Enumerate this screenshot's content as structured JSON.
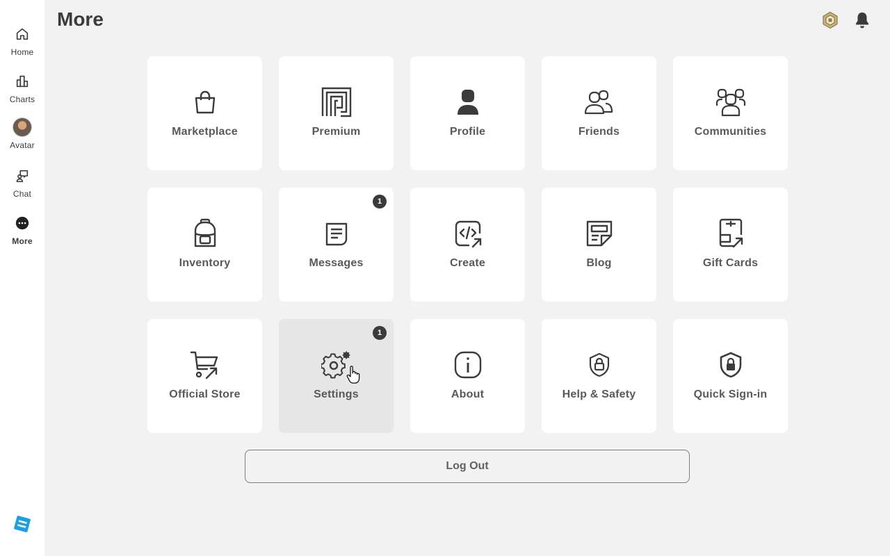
{
  "header": {
    "title": "More",
    "robux_icon": "robux-icon",
    "notification_icon": "bell-icon"
  },
  "sidebar": {
    "items": [
      {
        "label": "Home",
        "icon": "home-icon"
      },
      {
        "label": "Charts",
        "icon": "charts-icon"
      },
      {
        "label": "Avatar",
        "icon": "avatar-thumbnail"
      },
      {
        "label": "Chat",
        "icon": "chat-icon"
      },
      {
        "label": "More",
        "icon": "more-icon",
        "active": true
      }
    ],
    "logo": "roblox-logo"
  },
  "tiles": [
    {
      "label": "Marketplace",
      "icon": "shopping-bag-icon"
    },
    {
      "label": "Premium",
      "icon": "premium-icon"
    },
    {
      "label": "Profile",
      "icon": "profile-icon"
    },
    {
      "label": "Friends",
      "icon": "friends-icon"
    },
    {
      "label": "Communities",
      "icon": "communities-icon"
    },
    {
      "label": "Inventory",
      "icon": "backpack-icon"
    },
    {
      "label": "Messages",
      "icon": "message-icon",
      "badge": "1"
    },
    {
      "label": "Create",
      "icon": "code-icon"
    },
    {
      "label": "Blog",
      "icon": "blog-icon"
    },
    {
      "label": "Gift Cards",
      "icon": "gift-card-icon"
    },
    {
      "label": "Official Store",
      "icon": "cart-icon"
    },
    {
      "label": "Settings",
      "icon": "gear-icon",
      "badge": "1",
      "hovered": true
    },
    {
      "label": "About",
      "icon": "info-icon"
    },
    {
      "label": "Help & Safety",
      "icon": "shield-lock-icon"
    },
    {
      "label": "Quick Sign-in",
      "icon": "shield-lock-filled-icon"
    }
  ],
  "logout": {
    "label": "Log Out"
  },
  "colors": {
    "background": "#f2f2f2",
    "tile": "#ffffff",
    "tile_hover": "#e6e6e6",
    "text": "#393b3d",
    "logo_blue": "#1a9fe0"
  }
}
